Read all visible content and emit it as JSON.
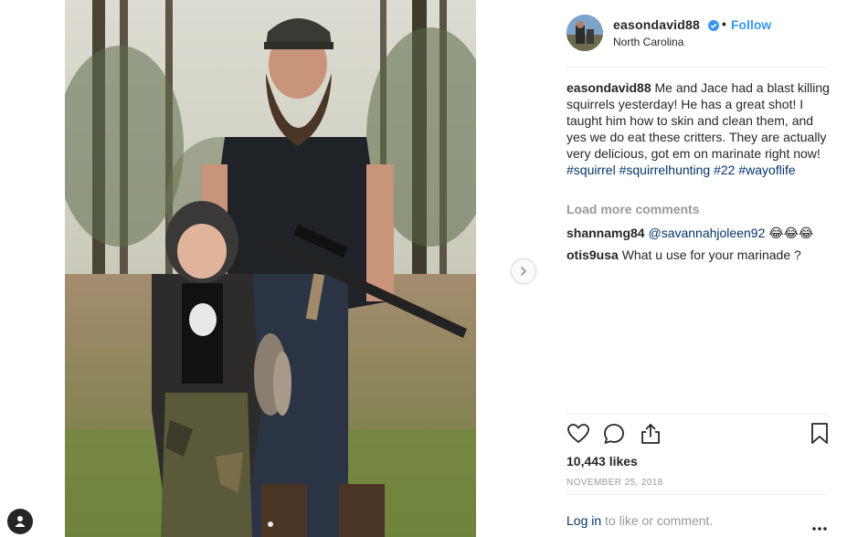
{
  "post": {
    "username": "easondavid88",
    "separator": "•",
    "follow_label": "Follow",
    "location": "North Carolina",
    "caption_user": "easondavid88",
    "caption_text": "Me and Jace had a blast killing squirrels yesterday! He has a great shot! I taught him how to skin and clean them, and yes we do eat these critters. They are actually very delicious, got em on marinate right now!",
    "hashtags": [
      "#squirrel",
      "#squirrelhunting",
      "#22",
      "#wayoflife"
    ],
    "load_more_label": "Load more comments",
    "comments": [
      {
        "user": "shannamg84",
        "mention": "@savannahjoleen92",
        "text": "😂😂😂"
      },
      {
        "user": "otis9usa",
        "mention": "",
        "text": "What u use for your marinade ?"
      }
    ],
    "likes": "10,443 likes",
    "date": "NOVEMBER 25, 2018",
    "login_link": "Log in",
    "login_text": " to like or comment."
  },
  "icons": {
    "verified": "verified-badge-icon",
    "like": "heart-icon",
    "comment": "comment-icon",
    "share": "share-icon",
    "save": "bookmark-icon",
    "next": "chevron-right-icon",
    "more": "ellipsis-icon",
    "profile": "user-icon"
  },
  "colors": {
    "link_blue": "#3897f0",
    "hashtag": "#003569",
    "muted": "#999999",
    "text": "#262626"
  }
}
